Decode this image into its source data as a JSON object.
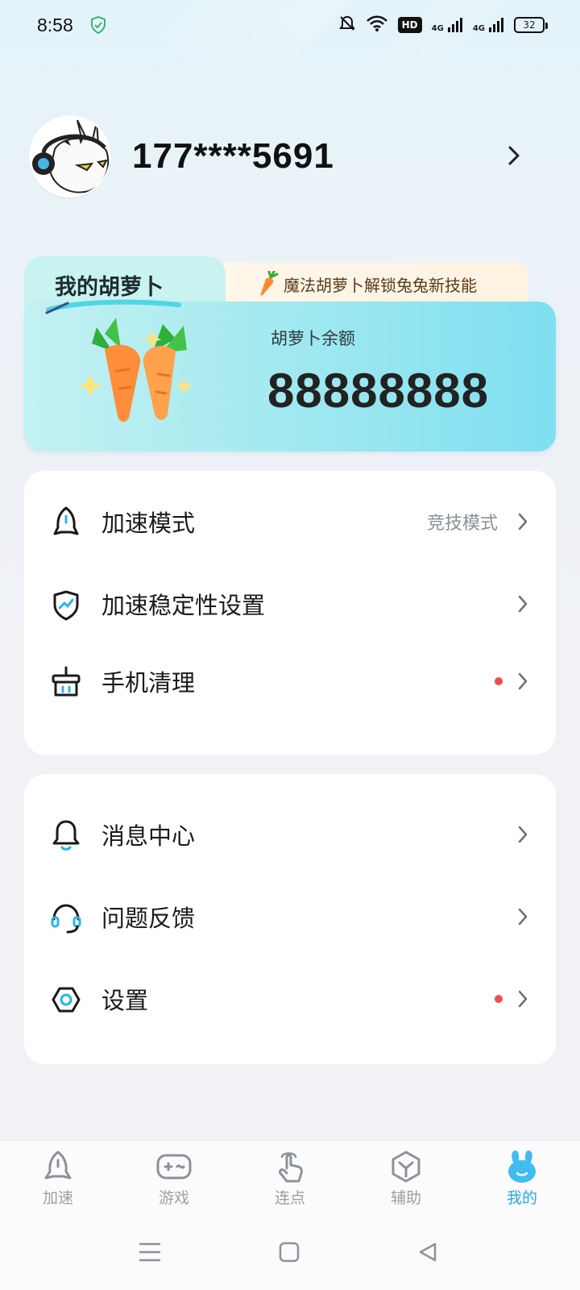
{
  "status_bar": {
    "time": "8:58",
    "battery": "32",
    "network_1": "4G",
    "network_2": "4G",
    "hd": "HD"
  },
  "profile": {
    "phone": "177****5691"
  },
  "carrot_card": {
    "title": "我的胡萝卜",
    "promo": "魔法胡萝卜解锁兔兔新技能",
    "balance_label": "胡萝卜余额",
    "balance_value": "88888888"
  },
  "menu_group_1": [
    {
      "label": "加速模式",
      "value": "竞技模式",
      "badge": false,
      "icon": "rocket-icon"
    },
    {
      "label": "加速稳定性设置",
      "value": "",
      "badge": false,
      "icon": "shield-trend-icon"
    },
    {
      "label": "手机清理",
      "value": "",
      "badge": true,
      "icon": "cleaning-basket-icon"
    }
  ],
  "menu_group_2": [
    {
      "label": "消息中心",
      "value": "",
      "badge": false,
      "icon": "bell-icon"
    },
    {
      "label": "问题反馈",
      "value": "",
      "badge": false,
      "icon": "headset-icon"
    },
    {
      "label": "设置",
      "value": "",
      "badge": true,
      "icon": "gear-icon"
    }
  ],
  "bottom_nav": [
    {
      "label": "加速",
      "icon": "rocket-icon",
      "active": false
    },
    {
      "label": "游戏",
      "icon": "gamepad-icon",
      "active": false
    },
    {
      "label": "连点",
      "icon": "tap-hand-icon",
      "active": false
    },
    {
      "label": "辅助",
      "icon": "cube-icon",
      "active": false
    },
    {
      "label": "我的",
      "icon": "rabbit-icon",
      "active": true
    }
  ],
  "colors": {
    "accent": "#26a9e9",
    "badge": "#ef4b55",
    "card_bg": "#ffffff"
  }
}
